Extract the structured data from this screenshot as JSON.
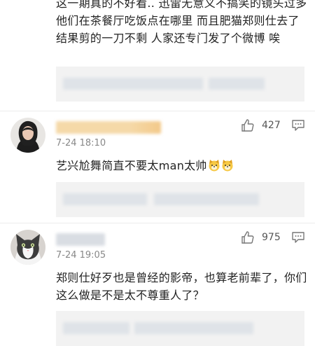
{
  "comments": [
    {
      "text": "这一期真的不好看.. 迅雷无意义不搞笑的镜头过多 他们在茶餐厅吃饭点在哪里 而且肥猫郑则仕去了 结果剪的一刀不剩 人家还专门发了个微博 唉"
    },
    {
      "time": "7-24 18:10",
      "likes": "427",
      "text": "艺兴尬舞简直不要太man太帅"
    },
    {
      "time": "7-24 19:05",
      "likes": "975",
      "text": "郑则仕好歹也是曾经的影帝，也算老前辈了，你们这么做是不是太不尊重人了？"
    }
  ],
  "colors": {
    "reply_background": "#f2f2f2",
    "icon_gray": "#777777",
    "username_blur": "#f5d9a8"
  },
  "icons": [
    "thumbs-up-icon",
    "reply-icon",
    "dog-emoji-icon"
  ]
}
